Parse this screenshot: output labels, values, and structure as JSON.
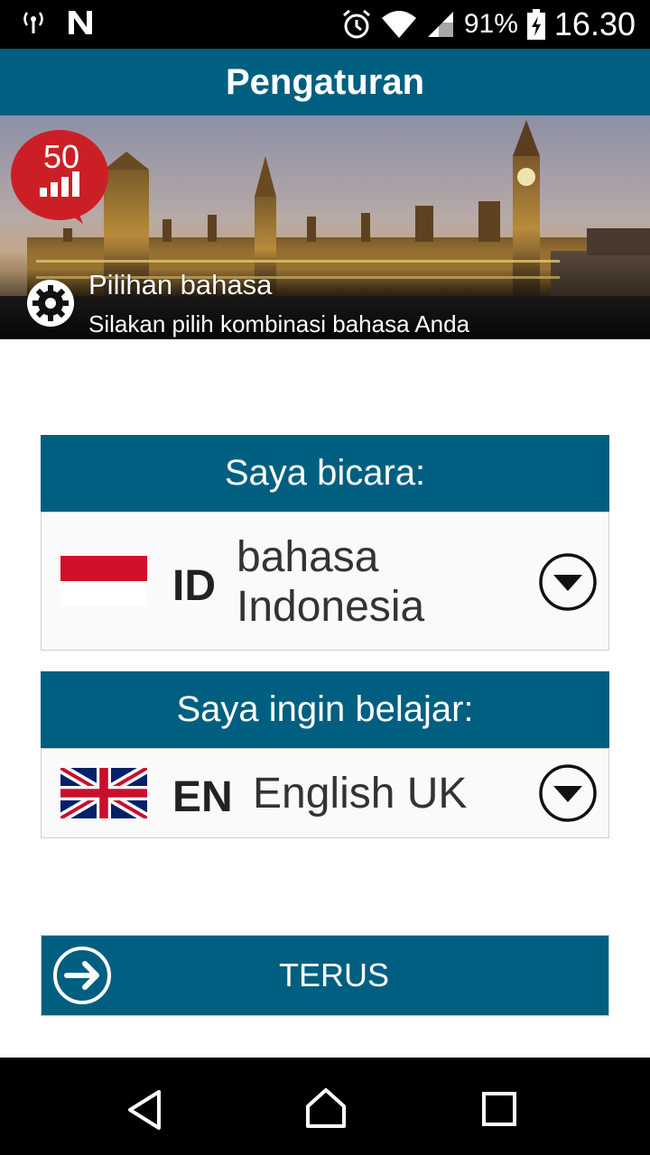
{
  "status_bar": {
    "battery": "91%",
    "time": "16.30",
    "icons": [
      "hotspot-icon",
      "n-notification-icon",
      "alarm-icon",
      "wifi-icon",
      "signal-icon",
      "battery-charging-icon"
    ]
  },
  "app_bar": {
    "title": "Pengaturan"
  },
  "banner": {
    "badge_number": "50",
    "title": "Pilihan bahasa",
    "subtitle": "Silakan pilih kombinasi bahasa Anda"
  },
  "speak": {
    "header": "Saya bicara:",
    "code": "ID",
    "name_line1": "bahasa",
    "name_line2": "Indonesia"
  },
  "learn": {
    "header": "Saya ingin belajar:",
    "code": "EN",
    "name": "English UK"
  },
  "continue": {
    "label": "TERUS"
  },
  "colors": {
    "primary": "#005f80",
    "badge_red": "#cc1f25"
  }
}
